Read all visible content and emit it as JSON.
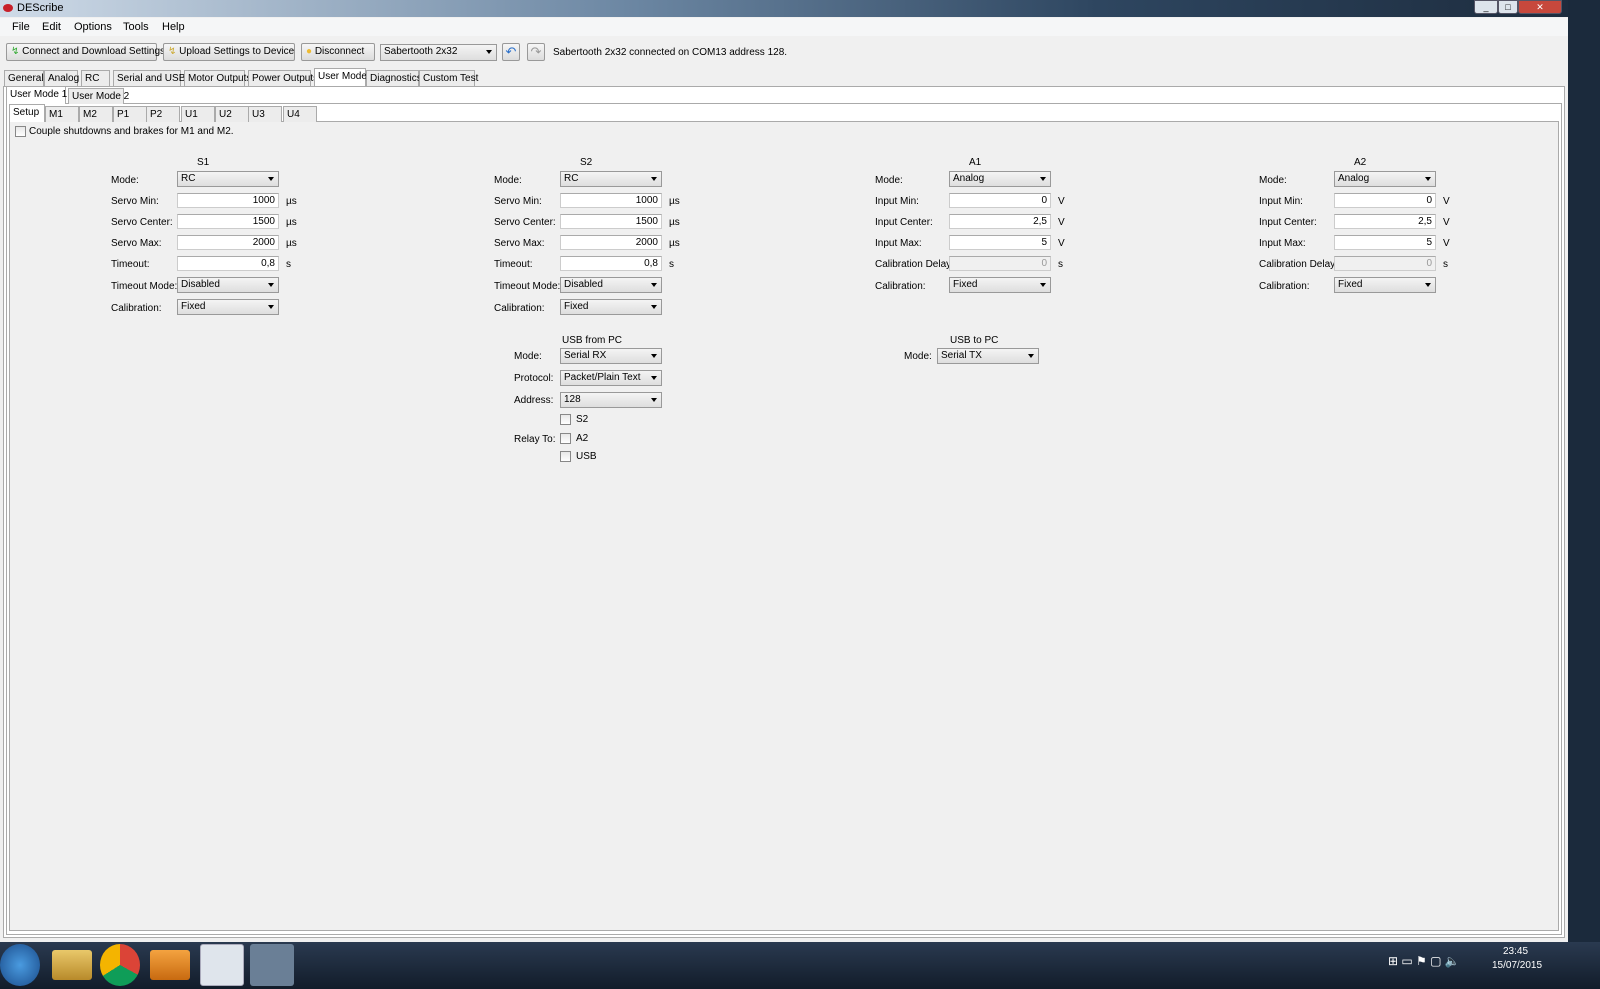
{
  "window": {
    "title": "DEScribe",
    "controls": [
      "_",
      "□",
      "✕"
    ]
  },
  "menu": [
    "File",
    "Edit",
    "Options",
    "Tools",
    "Help"
  ],
  "toolbar": {
    "connect": "Connect and Download Settings",
    "upload": "Upload Settings to Device",
    "disconnect": "Disconnect",
    "device": "Sabertooth 2x32",
    "status": "Sabertooth 2x32 connected on COM13 address 128."
  },
  "main_tabs": [
    "General",
    "Analog",
    "RC",
    "Serial and USB",
    "Motor Outputs",
    "Power Outputs",
    "User Mode",
    "Diagnostics",
    "Custom Test"
  ],
  "user_tabs": [
    "User Mode 1",
    "User Mode 2"
  ],
  "sub_tabs": [
    "Setup",
    "M1",
    "M2",
    "P1",
    "P2",
    "U1",
    "U2",
    "U3",
    "U4"
  ],
  "couple_label": "Couple shutdowns and brakes for M1 and M2.",
  "columns": [
    {
      "title": "S1",
      "rows": [
        [
          "Mode:",
          "combo",
          "RC",
          ""
        ],
        [
          "Servo Min:",
          "input",
          "1000",
          "µs"
        ],
        [
          "Servo Center:",
          "input",
          "1500",
          "µs"
        ],
        [
          "Servo Max:",
          "input",
          "2000",
          "µs"
        ],
        [
          "Timeout:",
          "input",
          "0,8",
          "s"
        ],
        [
          "Timeout Mode:",
          "combo",
          "Disabled",
          ""
        ],
        [
          "Calibration:",
          "combo",
          "Fixed",
          ""
        ]
      ]
    },
    {
      "title": "S2",
      "rows": [
        [
          "Mode:",
          "combo",
          "RC",
          ""
        ],
        [
          "Servo Min:",
          "input",
          "1000",
          "µs"
        ],
        [
          "Servo Center:",
          "input",
          "1500",
          "µs"
        ],
        [
          "Servo Max:",
          "input",
          "2000",
          "µs"
        ],
        [
          "Timeout:",
          "input",
          "0,8",
          "s"
        ],
        [
          "Timeout Mode:",
          "combo",
          "Disabled",
          ""
        ],
        [
          "Calibration:",
          "combo",
          "Fixed",
          ""
        ]
      ]
    },
    {
      "title": "A1",
      "rows": [
        [
          "Mode:",
          "combo",
          "Analog",
          ""
        ],
        [
          "Input Min:",
          "input",
          "0",
          "V"
        ],
        [
          "Input Center:",
          "input",
          "2,5",
          "V"
        ],
        [
          "Input Max:",
          "input",
          "5",
          "V"
        ],
        [
          "Calibration Delay:",
          "disabled",
          "0",
          "s"
        ],
        [
          "Calibration:",
          "combo",
          "Fixed",
          ""
        ]
      ]
    },
    {
      "title": "A2",
      "rows": [
        [
          "Mode:",
          "combo",
          "Analog",
          ""
        ],
        [
          "Input Min:",
          "input",
          "0",
          "V"
        ],
        [
          "Input Center:",
          "input",
          "2,5",
          "V"
        ],
        [
          "Input Max:",
          "input",
          "5",
          "V"
        ],
        [
          "Calibration Delay:",
          "disabled",
          "0",
          "s"
        ],
        [
          "Calibration:",
          "combo",
          "Fixed",
          ""
        ]
      ]
    }
  ],
  "usb_from": {
    "title": "USB from PC",
    "mode_label": "Mode:",
    "mode": "Serial RX",
    "protocol_label": "Protocol:",
    "protocol": "Packet/Plain Text",
    "address_label": "Address:",
    "address": "128",
    "relay_label": "Relay To:",
    "relay": [
      "S2",
      "A2",
      "USB"
    ]
  },
  "usb_to": {
    "title": "USB to PC",
    "mode_label": "Mode:",
    "mode": "Serial TX"
  },
  "clock": {
    "time": "23:45",
    "date": "15/07/2015"
  }
}
